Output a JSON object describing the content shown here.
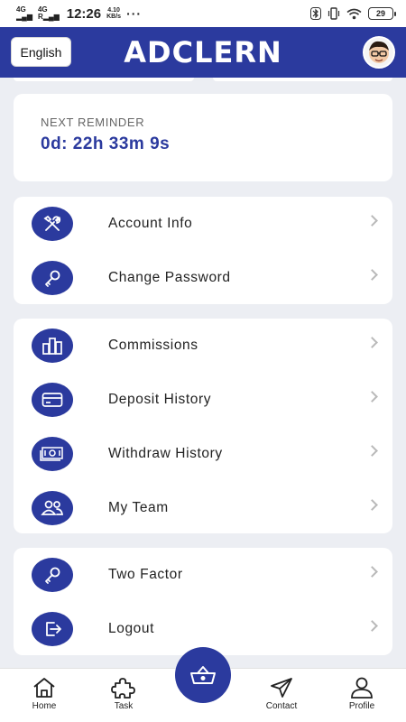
{
  "status_bar": {
    "net1_top": "4G",
    "net1_bottom": "",
    "net2_top": "4G",
    "net2_bottom": "R",
    "time": "12:26",
    "speed_value": "4.10",
    "speed_unit": "KB/s",
    "dots": "···",
    "battery": "29"
  },
  "header": {
    "language_label": "English",
    "brand": "ADCLERN"
  },
  "reminder": {
    "label": "NEXT REMINDER",
    "value": "0d: 22h 33m 9s"
  },
  "menu_group_1": [
    {
      "label": "Account Info",
      "icon": "tools-icon"
    },
    {
      "label": "Change Password",
      "icon": "key-icon"
    }
  ],
  "menu_group_2": [
    {
      "label": "Commissions",
      "icon": "bar-chart-icon"
    },
    {
      "label": "Deposit History",
      "icon": "credit-card-icon"
    },
    {
      "label": "Withdraw History",
      "icon": "cash-icon"
    },
    {
      "label": "My Team",
      "icon": "team-icon"
    }
  ],
  "menu_group_3": [
    {
      "label": "Two Factor",
      "icon": "key-icon"
    },
    {
      "label": "Logout",
      "icon": "logout-icon"
    }
  ],
  "bottom_nav": {
    "home": "Home",
    "task": "Task",
    "contact": "Contact",
    "profile": "Profile"
  },
  "colors": {
    "primary": "#2b3a9e",
    "background": "#eceef3"
  }
}
